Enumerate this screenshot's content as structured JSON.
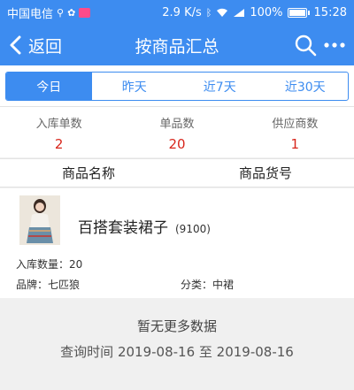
{
  "status_bar": {
    "carrier": "中国电信",
    "speed": "2.9 K/s",
    "battery": "100%",
    "time": "15:28"
  },
  "nav": {
    "back_label": "返回",
    "title": "按商品汇总"
  },
  "tabs": [
    {
      "label": "今日",
      "active": true
    },
    {
      "label": "昨天",
      "active": false
    },
    {
      "label": "近7天",
      "active": false
    },
    {
      "label": "近30天",
      "active": false
    }
  ],
  "stats": [
    {
      "label": "入库单数",
      "value": "2"
    },
    {
      "label": "单品数",
      "value": "20"
    },
    {
      "label": "供应商数",
      "value": "1"
    }
  ],
  "table_header": {
    "col_name": "商品名称",
    "col_code": "商品货号"
  },
  "product": {
    "name": "百搭套装裙子",
    "code": "(9100)",
    "qty": "入库数量：20",
    "brand": "品牌：七匹狼",
    "category": "分类：中裙"
  },
  "footer": {
    "no_more": "暂无更多数据",
    "query_time": "查询时间 2019-08-16 至 2019-08-16"
  },
  "colors": {
    "primary": "#3d8cf0",
    "stat_value": "#d8261c"
  }
}
